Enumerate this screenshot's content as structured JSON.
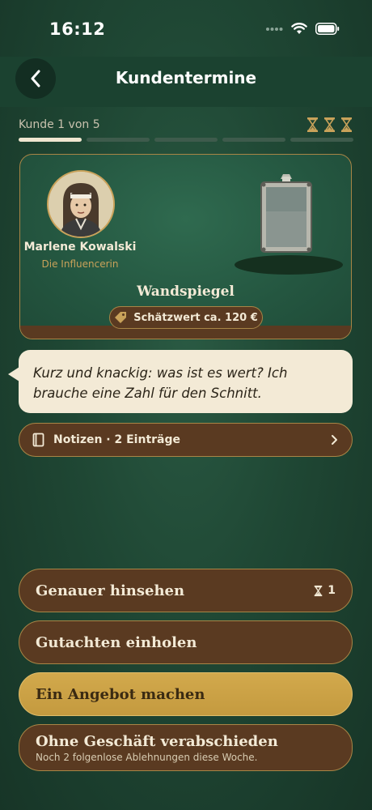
{
  "status": {
    "time": "16:12"
  },
  "header": {
    "title": "Kundentermine"
  },
  "progress": {
    "label": "Kunde 1 von 5",
    "current": 1,
    "total": 5,
    "hourglasses": 3
  },
  "customer": {
    "name": "Marlene Kowalski",
    "role": "Die Influencerin"
  },
  "item": {
    "name": "Wandspiegel",
    "estimate": "Schätzwert ca. 120 €"
  },
  "speech": {
    "text": "Kurz und knackig: was ist es wert? Ich brauche eine Zahl für den Schnitt."
  },
  "notes": {
    "label": "Notizen · 2 Einträge"
  },
  "actions": {
    "look_closer": {
      "label": "Genauer hinsehen",
      "cost": "1"
    },
    "appraisal": {
      "label": "Gutachten einholen"
    },
    "offer": {
      "label": "Ein Angebot machen"
    },
    "decline": {
      "label": "Ohne Geschäft verabschieden",
      "sub": "Noch 2 folgenlose Ablehnungen diese Woche."
    }
  },
  "colors": {
    "background": "#1f4734",
    "accent": "#c9a25a",
    "button": "#5a3a21",
    "primary": "#c49a3f",
    "cream": "#f3ead6"
  }
}
